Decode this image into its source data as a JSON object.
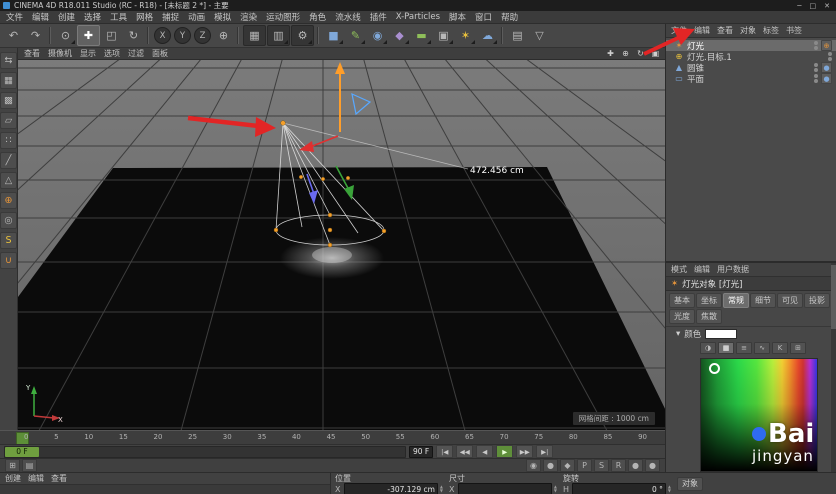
{
  "window": {
    "title": "CINEMA 4D R18.011 Studio (RC - R18) - [未标题 2 *] - 主要",
    "minimize": "─",
    "maximize": "□",
    "close": "✕"
  },
  "menubar": {
    "items": [
      "文件",
      "编辑",
      "创建",
      "选择",
      "工具",
      "网格",
      "捕捉",
      "动画",
      "模拟",
      "渲染",
      "运动图形",
      "角色",
      "流水线",
      "插件",
      "X-Particles",
      "脚本",
      "窗口",
      "帮助"
    ]
  },
  "toolbar": {
    "icons": [
      {
        "name": "undo",
        "g": "↶"
      },
      {
        "name": "redo",
        "g": "↷"
      },
      {
        "name": "live-selection",
        "g": "⊙"
      },
      {
        "name": "move",
        "g": "✚"
      },
      {
        "name": "scale",
        "g": "◰"
      },
      {
        "name": "rotate",
        "g": "↻"
      },
      {
        "name": "lock-x",
        "g": "X"
      },
      {
        "name": "lock-y",
        "g": "Y"
      },
      {
        "name": "lock-z",
        "g": "Z"
      },
      {
        "name": "coordinate-system",
        "g": "⊕"
      },
      {
        "name": "render-view",
        "g": "▦"
      },
      {
        "name": "render-picture-viewer",
        "g": "▥"
      },
      {
        "name": "render-settings",
        "g": "⚙"
      },
      {
        "name": "add-cube",
        "g": "■"
      },
      {
        "name": "spline-pen",
        "g": "✎"
      },
      {
        "name": "subdivision-surface",
        "g": "◉"
      },
      {
        "name": "generators",
        "g": "◆"
      },
      {
        "name": "floor",
        "g": "▬"
      },
      {
        "name": "camera",
        "g": "▣"
      },
      {
        "name": "light",
        "g": "✶"
      },
      {
        "name": "environment",
        "g": "☁"
      },
      {
        "name": "display-mode",
        "g": "▤"
      },
      {
        "name": "filter-menu",
        "g": "▽"
      }
    ]
  },
  "left_toolbar": {
    "icons": [
      {
        "name": "make-editable",
        "g": "⇆"
      },
      {
        "name": "model-mode",
        "g": "▦"
      },
      {
        "name": "texture-mode",
        "g": "▩"
      },
      {
        "name": "workplane-mode",
        "g": "▱"
      },
      {
        "name": "points-mode",
        "g": "∷"
      },
      {
        "name": "edges-mode",
        "g": "╱"
      },
      {
        "name": "polygons-mode",
        "g": "△"
      },
      {
        "name": "enable-axis",
        "g": "⊕"
      },
      {
        "name": "viewport-solo",
        "g": "◎"
      },
      {
        "name": "snap-toggle",
        "g": "S"
      },
      {
        "name": "magnet-snap",
        "g": "∪"
      }
    ]
  },
  "viewport": {
    "menus": [
      "查看",
      "摄像机",
      "显示",
      "选项",
      "过滤",
      "面板"
    ],
    "nav_icons": [
      {
        "name": "pan-view",
        "g": "✚"
      },
      {
        "name": "zoom-view",
        "g": "⊕"
      },
      {
        "name": "rotate-view",
        "g": "↻"
      },
      {
        "name": "toggle-view",
        "g": "▣"
      }
    ],
    "measurement": "472.456 cm",
    "grid_label": "网格间距 : 1000 cm",
    "axis_x": "X",
    "axis_y": "Y"
  },
  "timeline": {
    "ticks": [
      "0",
      "5",
      "10",
      "15",
      "20",
      "25",
      "30",
      "35",
      "40",
      "45",
      "50",
      "55",
      "60",
      "65",
      "70",
      "75",
      "80",
      "85",
      "90"
    ]
  },
  "transport": {
    "start_frame": "0 F",
    "end_frame": "90 F",
    "buttons": [
      {
        "name": "goto-start",
        "g": "|◀"
      },
      {
        "name": "prev-key",
        "g": "◀◀"
      },
      {
        "name": "prev-frame",
        "g": "◀"
      },
      {
        "name": "play",
        "g": "▶"
      },
      {
        "name": "next-frame",
        "g": "▶▶"
      },
      {
        "name": "goto-end",
        "g": "▶|"
      }
    ],
    "record_icons": [
      {
        "name": "record-keyframe",
        "g": "◉"
      },
      {
        "name": "autokey-toggle",
        "g": "●"
      },
      {
        "name": "keyframe-selection",
        "g": "◆"
      },
      {
        "name": "record-position",
        "g": "P"
      },
      {
        "name": "record-scale",
        "g": "S"
      },
      {
        "name": "record-rotation",
        "g": "R"
      },
      {
        "name": "record-parameter",
        "g": "●"
      },
      {
        "name": "record-pla",
        "g": "●"
      }
    ]
  },
  "material_manager": {
    "menus": [
      "创建",
      "编辑",
      "查看"
    ]
  },
  "coordinates": {
    "columns": [
      {
        "header": "位置",
        "axis": "X",
        "value": "-307.129 cm"
      },
      {
        "header": "尺寸",
        "axis": "X",
        "value": ""
      },
      {
        "header": "旋转",
        "axis": "H",
        "value": "0 °"
      }
    ],
    "object_mode": "对象"
  },
  "object_manager": {
    "menus": [
      "文件",
      "编辑",
      "查看",
      "对象",
      "标签",
      "书签"
    ],
    "objects": [
      {
        "label": "灯光",
        "g": "✶"
      },
      {
        "label": "灯光.目标.1",
        "g": "⊕"
      },
      {
        "label": "圆锥",
        "g": "▲"
      },
      {
        "label": "平面",
        "g": "▭"
      }
    ]
  },
  "attribute_manager": {
    "menus": [
      "模式",
      "编辑",
      "用户数据"
    ],
    "title": "灯光对象 [灯光]",
    "tabs": [
      "基本",
      "坐标",
      "常规",
      "细节",
      "可见",
      "投影",
      "光度",
      "焦散"
    ],
    "color_label": "颜色",
    "color_value": "#FFFFFF",
    "picker_modes": [
      {
        "name": "wheel-mode",
        "g": "◑"
      },
      {
        "name": "spectrum-mode",
        "g": "▦"
      },
      {
        "name": "rgb-mode",
        "g": "≡"
      },
      {
        "name": "hsv-mode",
        "g": "∿"
      },
      {
        "name": "kelvin-mode",
        "g": "K"
      },
      {
        "name": "swatches-mode",
        "g": "⊞"
      }
    ]
  },
  "watermark": {
    "line1": "Bai",
    "line2": "jingyan"
  }
}
